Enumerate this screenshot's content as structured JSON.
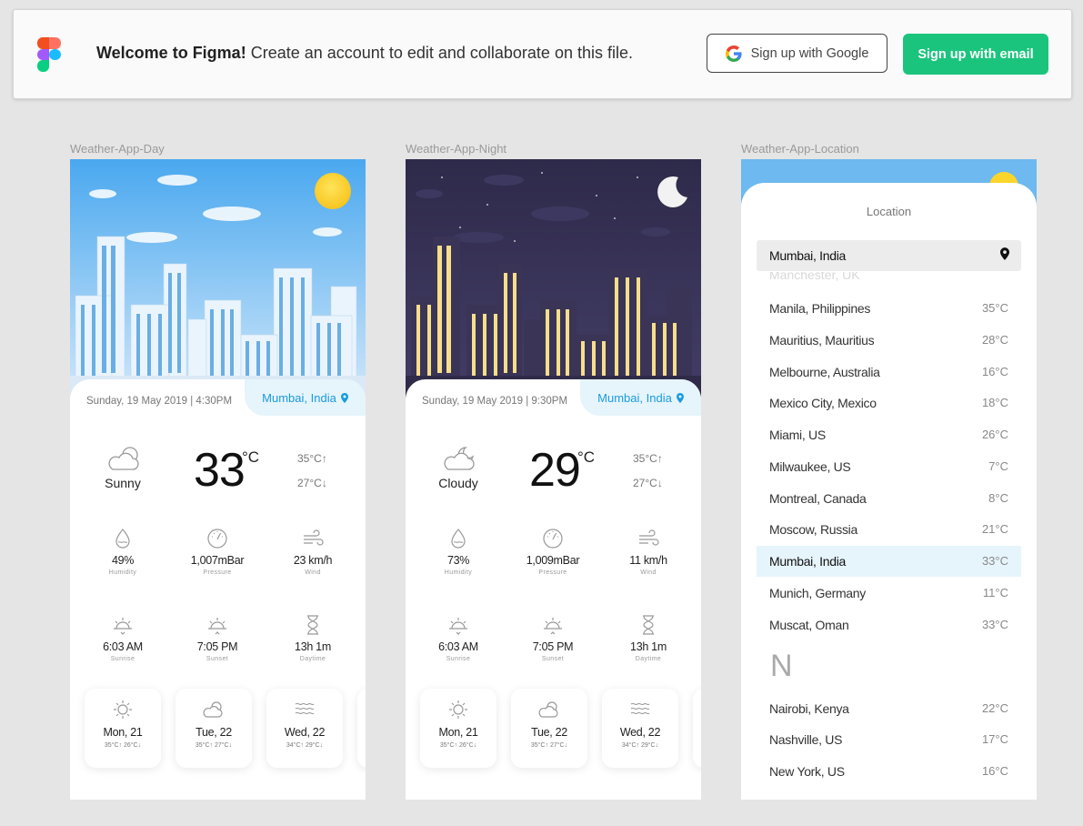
{
  "banner": {
    "welcome_bold": "Welcome to Figma!",
    "welcome_text": "Create an account to edit and collaborate on this file.",
    "google_button": "Sign up with Google",
    "email_button": "Sign up with email",
    "accent": "#1bc47d"
  },
  "frames": {
    "day_label": "Weather-App-Day",
    "night_label": "Weather-App-Night",
    "location_label": "Weather-App-Location"
  },
  "day": {
    "date": "Sunday, 19 May 2019 | 4:30PM",
    "location": "Mumbai, India",
    "condition": "Sunny",
    "temp": "33",
    "unit": "°C",
    "high": "35°C↑",
    "low": "27°C↓",
    "humidity": "49%",
    "humidity_label": "Humidity",
    "pressure": "1,007mBar",
    "pressure_label": "Pressure",
    "wind": "23 km/h",
    "wind_label": "Wind",
    "sunrise": "6:03 AM",
    "sunrise_label": "Sunrise",
    "sunset": "7:05 PM",
    "sunset_label": "Sunset",
    "daytime": "13h 1m",
    "daytime_label": "Daytime",
    "forecast": [
      {
        "day": "Mon, 21",
        "range": "35°C↑  26°C↓"
      },
      {
        "day": "Tue, 22",
        "range": "35°C↑  27°C↓"
      },
      {
        "day": "Wed, 22",
        "range": "34°C↑  29°C↓"
      }
    ]
  },
  "night": {
    "date": "Sunday, 19 May 2019 | 9:30PM",
    "location": "Mumbai, India",
    "condition": "Cloudy",
    "temp": "29",
    "unit": "°C",
    "high": "35°C↑",
    "low": "27°C↓",
    "humidity": "73%",
    "humidity_label": "Humidity",
    "pressure": "1,009mBar",
    "pressure_label": "Pressure",
    "wind": "11 km/h",
    "wind_label": "Wind",
    "sunrise": "6:03 AM",
    "sunrise_label": "Sunrise",
    "sunset": "7:05 PM",
    "sunset_label": "Sunset",
    "daytime": "13h 1m",
    "daytime_label": "Daytime",
    "forecast": [
      {
        "day": "Mon, 21",
        "range": "35°C↑  26°C↓"
      },
      {
        "day": "Tue, 22",
        "range": "35°C↑  27°C↓"
      },
      {
        "day": "Wed, 22",
        "range": "34°C↑  29°C↓"
      }
    ]
  },
  "location": {
    "title": "Location",
    "search_value": "Mumbai, India",
    "ghost_text": "Manchester, UK",
    "cities": [
      {
        "name": "Manila, Philippines",
        "temp": "35°C"
      },
      {
        "name": "Mauritius, Mauritius",
        "temp": "28°C"
      },
      {
        "name": "Melbourne, Australia",
        "temp": "16°C"
      },
      {
        "name": "Mexico City, Mexico",
        "temp": "18°C"
      },
      {
        "name": "Miami, US",
        "temp": "26°C"
      },
      {
        "name": "Milwaukee, US",
        "temp": "7°C"
      },
      {
        "name": "Montreal, Canada",
        "temp": "8°C"
      },
      {
        "name": "Moscow, Russia",
        "temp": "21°C"
      },
      {
        "name": "Mumbai, India",
        "temp": "33°C"
      },
      {
        "name": "Munich, Germany",
        "temp": "11°C"
      },
      {
        "name": "Muscat, Oman",
        "temp": "33°C"
      }
    ],
    "section_letter": "N",
    "cities_n": [
      {
        "name": "Nairobi, Kenya",
        "temp": "22°C"
      },
      {
        "name": "Nashville, US",
        "temp": "17°C"
      },
      {
        "name": "New York, US",
        "temp": "16°C"
      }
    ]
  }
}
